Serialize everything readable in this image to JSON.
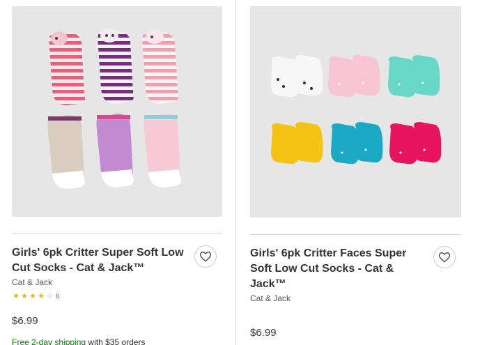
{
  "colors": {
    "star_filled": "#f7b500",
    "star_empty": "#b0b0b0",
    "shipping_green": "#008300",
    "text": "#333333",
    "photo_background": "#e6e6e6"
  },
  "products": [
    {
      "title": "Girls' 6pk Critter Super Soft Low Cut Socks - Cat & Jack™",
      "brand": "Cat & Jack",
      "rating": {
        "stars": 4,
        "max": 5,
        "count": "6"
      },
      "price": "$6.99",
      "shipping": {
        "link": "Free 2-day shipping",
        "rest": " with $35 orders"
      },
      "favorite_icon": "heart-outline-icon"
    },
    {
      "title": "Girls' 6pk Critter Faces Super Soft Low Cut Socks - Cat & Jack™",
      "brand": "Cat & Jack",
      "price": "$6.99",
      "favorite_icon": "heart-outline-icon"
    }
  ]
}
